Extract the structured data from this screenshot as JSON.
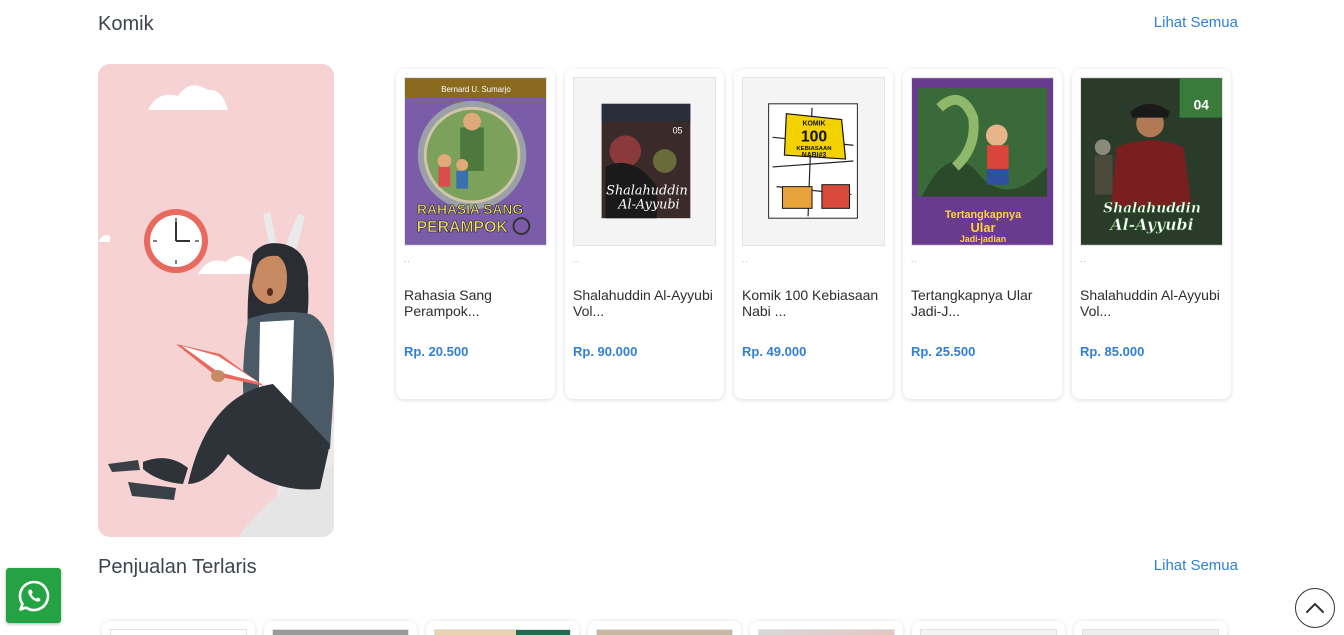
{
  "sections": {
    "komik": {
      "title": "Komik",
      "see_all": "Lihat Semua"
    },
    "terlaris": {
      "title": "Penjualan Terlaris",
      "see_all": "Lihat Semua"
    }
  },
  "products": [
    {
      "meta": "..",
      "name": "Rahasia Sang Perampok...",
      "price": "Rp. 20.500",
      "cover": {
        "bg": "#7b5ca8",
        "text_top": "Bernard U. Sumarjo",
        "text_main": "RAHASIA SANG PEROMPOK"
      }
    },
    {
      "meta": "..",
      "name": "Shalahuddin Al-Ayyubi Vol...",
      "price": "Rp. 90.000",
      "cover": {
        "bg": "#f4f4f4",
        "text_main": "Shalahuddin Al-Ayyubi",
        "number": "05"
      }
    },
    {
      "meta": "..",
      "name": "Komik 100 Kebiasaan Nabi ...",
      "price": "Rp. 49.000",
      "cover": {
        "bg": "#f4f4f4",
        "text_top": "KOMIK",
        "text_main": "100 KEBIASAAN NABI#3"
      }
    },
    {
      "meta": "..",
      "name": "Tertangkapnya Ular Jadi-J...",
      "price": "Rp. 25.500",
      "cover": {
        "bg": "#6a3a8e",
        "text_main": "Tertangkapnya Ular Jadi-jadian"
      }
    },
    {
      "meta": "..",
      "name": "Shalahuddin Al-Ayyubi Vol...",
      "price": "Rp. 85.000",
      "cover": {
        "bg": "#2b3b2a",
        "text_main": "Shalahuddin Al-Ayyubi",
        "number": "04"
      }
    }
  ],
  "colors": {
    "accent": "#2f7fd6",
    "banner_bg": "#f6d2d3",
    "whatsapp": "#25a244"
  },
  "icons": {
    "whatsapp": "whatsapp-icon",
    "scroll_top": "chevron-up-icon"
  }
}
